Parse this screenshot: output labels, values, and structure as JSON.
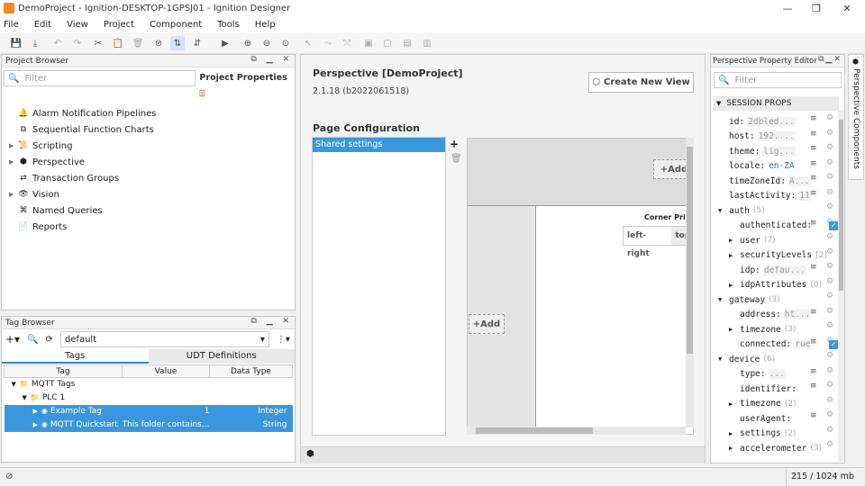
{
  "window": {
    "title": "DemoProject - Ignition-DESKTOP-1GPSJ01 - Ignition Designer",
    "minimize": "—",
    "maximize": "❐",
    "close": "✕"
  },
  "menu": [
    "File",
    "Edit",
    "View",
    "Project",
    "Component",
    "Tools",
    "Help"
  ],
  "project_browser": {
    "title": "Project Browser",
    "filter_placeholder": "Filter",
    "properties_tab": "Project Properties",
    "items": [
      {
        "label": "Alarm Notification Pipelines",
        "icon": "bell-icon",
        "expand": ""
      },
      {
        "label": "Sequential Function Charts",
        "icon": "flowchart-icon",
        "expand": ""
      },
      {
        "label": "Scripting",
        "icon": "script-icon",
        "expand": "▶"
      },
      {
        "label": "Perspective",
        "icon": "perspective-icon",
        "expand": "▶"
      },
      {
        "label": "Transaction Groups",
        "icon": "transaction-icon",
        "expand": ""
      },
      {
        "label": "Vision",
        "icon": "vision-icon",
        "expand": "▶"
      },
      {
        "label": "Named Queries",
        "icon": "query-icon",
        "expand": ""
      },
      {
        "label": "Reports",
        "icon": "report-icon",
        "expand": ""
      }
    ]
  },
  "tag_browser": {
    "title": "Tag Browser",
    "provider": "default",
    "tabs": [
      "Tags",
      "UDT Definitions"
    ],
    "columns": [
      "Tag",
      "Value",
      "Data Type"
    ],
    "rows": [
      {
        "tag": "MQTT Tags",
        "value": "",
        "type": "",
        "indent": 1,
        "expand": "▼"
      },
      {
        "tag": "PLC 1",
        "value": "",
        "type": "",
        "indent": 2,
        "expand": "▼"
      },
      {
        "tag": "Example Tag",
        "value": "1",
        "type": "Integer",
        "indent": 3,
        "expand": "▶"
      },
      {
        "tag": "MQTT Quickstart",
        "value": "This folder contains...",
        "type": "String",
        "indent": 3,
        "expand": "▶"
      }
    ]
  },
  "center": {
    "heading": "Perspective [DemoProject]",
    "version": "2.1.18 (b2022061518)",
    "create_view": "Create New View",
    "page_config": "Page Configuration",
    "shared_settings": "Shared settings",
    "add_label": "Add",
    "corner_label": "Corner Prio",
    "left_right": "left-right",
    "top_label": "top-"
  },
  "property_editor": {
    "title": "Perspective Property Editor",
    "filter_placeholder": "Filter",
    "section": "SESSION PROPS",
    "side_tab": "Perspective Components",
    "rows": [
      {
        "key": "id",
        "val": "2dbled...",
        "indent": 0,
        "expand": "",
        "count": "",
        "blue": false
      },
      {
        "key": "host",
        "val": "192....",
        "indent": 0,
        "expand": "",
        "count": "",
        "blue": false
      },
      {
        "key": "theme",
        "val": "lig...",
        "indent": 0,
        "expand": "",
        "count": "",
        "blue": false
      },
      {
        "key": "locale",
        "val": "en-ZA",
        "indent": 0,
        "expand": "",
        "count": "",
        "blue": true
      },
      {
        "key": "timeZoneId",
        "val": "A...",
        "indent": 0,
        "expand": "",
        "count": "",
        "blue": false
      },
      {
        "key": "lastActivity",
        "val": "11",
        "indent": 0,
        "expand": "",
        "count": "",
        "blue": false
      },
      {
        "key": "auth",
        "val": "",
        "indent": 0,
        "expand": "▼",
        "count": "(5)",
        "blue": false
      },
      {
        "key": "authenticated",
        "val": "",
        "indent": 1,
        "expand": "",
        "count": "",
        "blue": false
      },
      {
        "key": "user",
        "val": "",
        "indent": 1,
        "expand": "▶",
        "count": "(7)",
        "blue": false
      },
      {
        "key": "securityLevels",
        "val": "",
        "indent": 1,
        "expand": "▶",
        "count": "[2]",
        "blue": false
      },
      {
        "key": "idp",
        "val": "defau...",
        "indent": 1,
        "expand": "",
        "count": "",
        "blue": false
      },
      {
        "key": "idpAttributes",
        "val": "",
        "indent": 1,
        "expand": "▶",
        "count": "(0)",
        "blue": false
      },
      {
        "key": "gateway",
        "val": "",
        "indent": 0,
        "expand": "▼",
        "count": "(3)",
        "blue": false
      },
      {
        "key": "address",
        "val": "ht...",
        "indent": 1,
        "expand": "",
        "count": "",
        "blue": false
      },
      {
        "key": "timezone",
        "val": "",
        "indent": 1,
        "expand": "▶",
        "count": "(3)",
        "blue": false
      },
      {
        "key": "connected",
        "val": "rue",
        "indent": 1,
        "expand": "",
        "count": "",
        "blue": false
      },
      {
        "key": "device",
        "val": "",
        "indent": 0,
        "expand": "▼",
        "count": "(6)",
        "blue": false
      },
      {
        "key": "type",
        "val": "...",
        "indent": 1,
        "expand": "",
        "count": "",
        "blue": false
      },
      {
        "key": "identifier",
        "val": "",
        "indent": 1,
        "expand": "",
        "count": "",
        "blue": false
      },
      {
        "key": "timezone",
        "val": "",
        "indent": 1,
        "expand": "▶",
        "count": "(2)",
        "blue": false
      },
      {
        "key": "userAgent",
        "val": "",
        "indent": 1,
        "expand": "",
        "count": "",
        "blue": false
      },
      {
        "key": "settings",
        "val": "",
        "indent": 1,
        "expand": "▶",
        "count": "(2)",
        "blue": false
      },
      {
        "key": "accelerometer",
        "val": "",
        "indent": 1,
        "expand": "▶",
        "count": "(3)",
        "blue": false
      }
    ]
  },
  "status": {
    "memory": "215 / 1024 mb"
  },
  "colors": {
    "accent": "#3a97dd",
    "selection": "#3a97dd"
  }
}
